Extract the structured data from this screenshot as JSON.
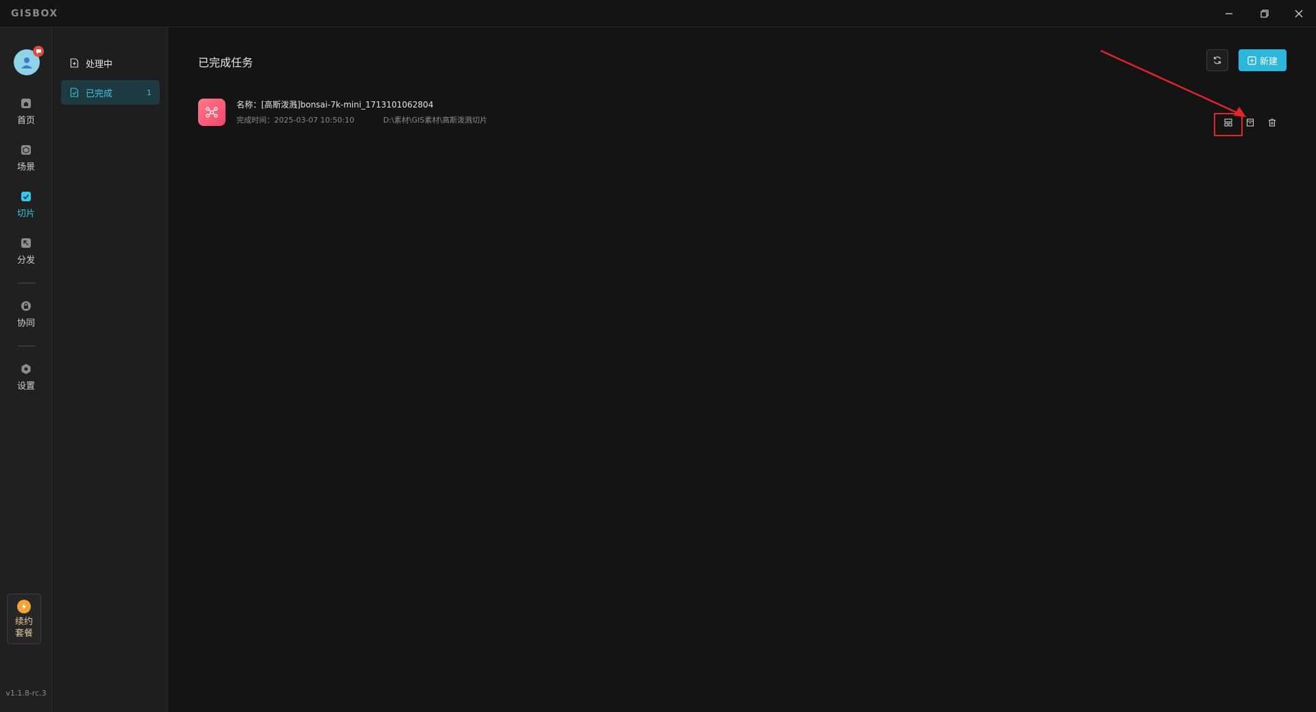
{
  "app": {
    "logo_text": "GISBOX",
    "version": "v1.1.8-rc.3"
  },
  "window_controls": [
    {
      "name": "minimize-button",
      "icon": "minimize-icon"
    },
    {
      "name": "restore-button",
      "icon": "restore-icon"
    },
    {
      "name": "close-button",
      "icon": "close-icon"
    }
  ],
  "rail": {
    "items": [
      {
        "label": "首页",
        "icon": "home-icon"
      },
      {
        "label": "场景",
        "icon": "cube-icon"
      },
      {
        "label": "切片",
        "icon": "slice-icon",
        "active": true
      },
      {
        "label": "分发",
        "icon": "distribute-icon"
      },
      {
        "label": "协同",
        "icon": "lock-icon"
      },
      {
        "label": "设置",
        "icon": "gear-icon"
      }
    ],
    "plan": {
      "line1": "续约",
      "line2": "套餐",
      "icon": "bolt-icon"
    }
  },
  "subnav": {
    "items": [
      {
        "label": "处理中",
        "icon": "file-add-icon",
        "count": ""
      },
      {
        "label": "已完成",
        "icon": "file-check-icon",
        "count": "1",
        "active": true
      }
    ]
  },
  "main": {
    "title": "已完成任务",
    "new_button": "新建",
    "task": {
      "name": "名称：[高斯泼溅]bonsai-7k-mini_1713101062804",
      "finished": "完成时间：2025-03-07 10:50:10",
      "path": "D:\\素材\\GIS素材\\高斯泼溅切片"
    }
  },
  "colors": {
    "accent": "#38c6e8",
    "primary_button": "#2cb6dc",
    "highlight_box": "#e1252b",
    "task_icon": "#f0466b"
  }
}
